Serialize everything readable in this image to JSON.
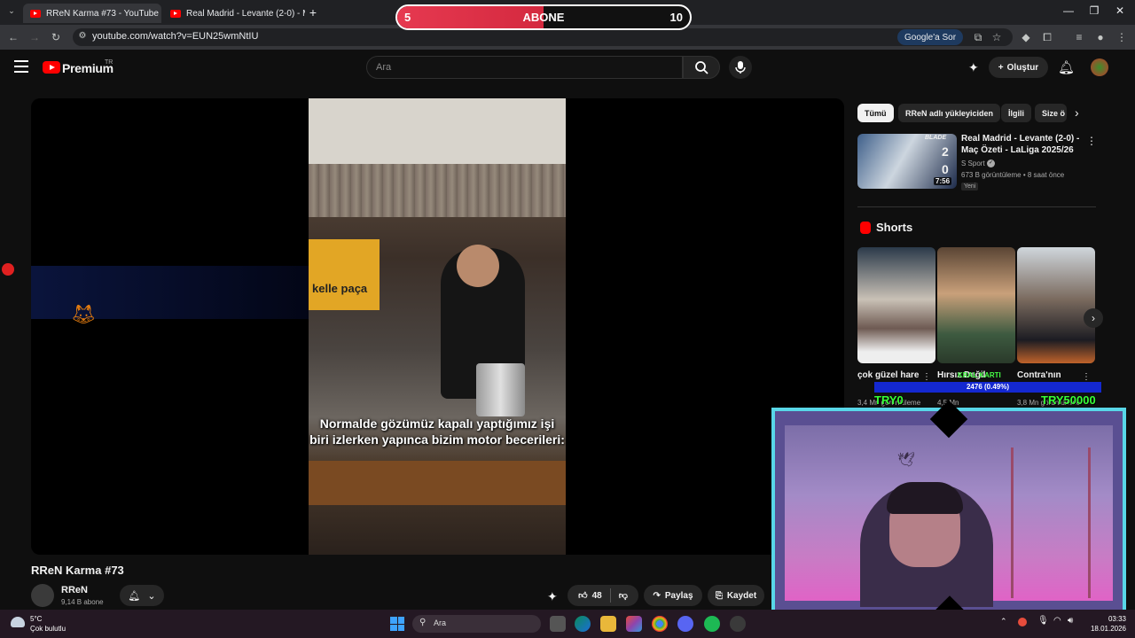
{
  "browser": {
    "tabs": [
      {
        "title": "RReN Karma #73 - YouTube"
      },
      {
        "title": "Real Madrid - Levante (2-0) - M"
      }
    ],
    "url": "youtube.com/watch?v=EUN25wmNtIU",
    "google_ask": "Google'a Sor"
  },
  "subscriber_goal": {
    "current": "5",
    "label": "ABONE",
    "goal": "10",
    "progress_fraction": 0.5
  },
  "header": {
    "logo_text": "Premium",
    "region": "TR",
    "search_placeholder": "Ara",
    "create_label": "Oluştur"
  },
  "video": {
    "caption": "Normalde gözümüz kapalı yaptığımız işi biri izlerken yapınca bizim motor becerileri:",
    "sign_text": "kelle paça",
    "title": "RReN Karma #73",
    "channel": "RReN",
    "subscribers": "9,14 B abone",
    "likes": "48",
    "share_label": "Paylaş",
    "save_label": "Kaydet"
  },
  "sidebar": {
    "chips": [
      "Tümü",
      "RReN adlı yükleyiciden",
      "İlgili",
      "Size ö"
    ],
    "recommendation": {
      "title": "Real Madrid - Levante (2-0) - Maç Özeti - LaLiga 2025/26",
      "channel": "S Sport",
      "meta": "673 B görüntüleme • 8 saat önce",
      "badge": "Yeni",
      "duration": "7:56",
      "score_home": "2",
      "score_away": "0",
      "brand": "BLADE"
    },
    "shorts_title": "Shorts",
    "shorts": [
      {
        "title": "çok güzel hare",
        "views": "3,4 Mn görüntüleme"
      },
      {
        "title": "Hırsız Değil",
        "views": "4,5 Mn"
      },
      {
        "title": "Contra'nın",
        "views": "3,8 Mn görüntüleme"
      }
    ]
  },
  "donation_overlay": {
    "heading": "KRAL KARTI",
    "progress": "2476 (0.49%)",
    "left_amount": "TRY0",
    "right_amount": "TRY50000"
  },
  "taskbar": {
    "weather_temp": "5°C",
    "weather_desc": "Çok bulutlu",
    "search_label": "Ara",
    "time": "03:33",
    "date": "18.01.2026"
  },
  "colors": {
    "accent": "#ff0000",
    "goal_bar": "#e63950",
    "cam_border": "#58d7e8",
    "donation_text": "#37ff37"
  }
}
